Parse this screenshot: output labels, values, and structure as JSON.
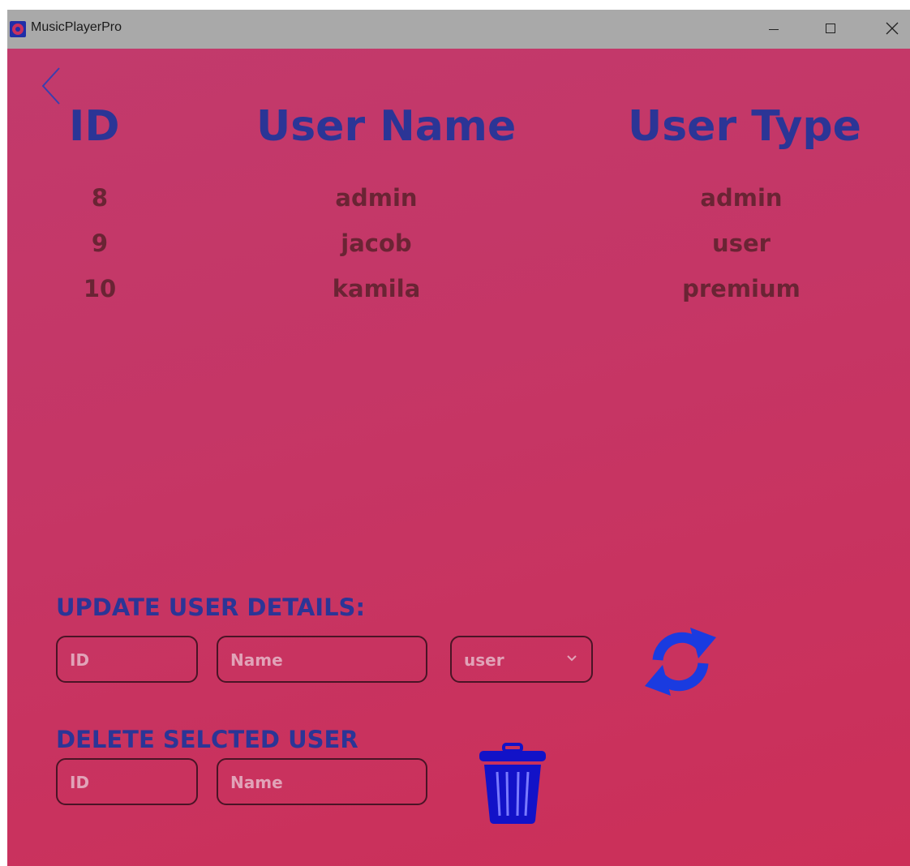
{
  "window": {
    "title": "MusicPlayerPro"
  },
  "table": {
    "headers": {
      "id": "ID",
      "name": "User Name",
      "type": "User Type"
    },
    "rows": [
      {
        "id": "8",
        "name": "admin",
        "type": "admin"
      },
      {
        "id": "9",
        "name": "jacob",
        "type": "user"
      },
      {
        "id": "10",
        "name": "kamila",
        "type": "premium"
      }
    ]
  },
  "update": {
    "label": "UPDATE USER DETAILS:",
    "id_placeholder": "ID",
    "name_placeholder": "Name",
    "type_selected": "user"
  },
  "delete": {
    "label": "DELETE SELCTED USER",
    "id_placeholder": "ID",
    "name_placeholder": "Name"
  },
  "icons": {
    "app": "headphones-icon",
    "back": "back-arrow-icon",
    "refresh": "refresh-icon",
    "trash": "trash-icon"
  },
  "colors": {
    "heading": "#2b3596",
    "cell_text": "#6a2434",
    "icon_blue": "#1a3be0",
    "trash_blue": "#1212c8",
    "background": "#c53666"
  }
}
